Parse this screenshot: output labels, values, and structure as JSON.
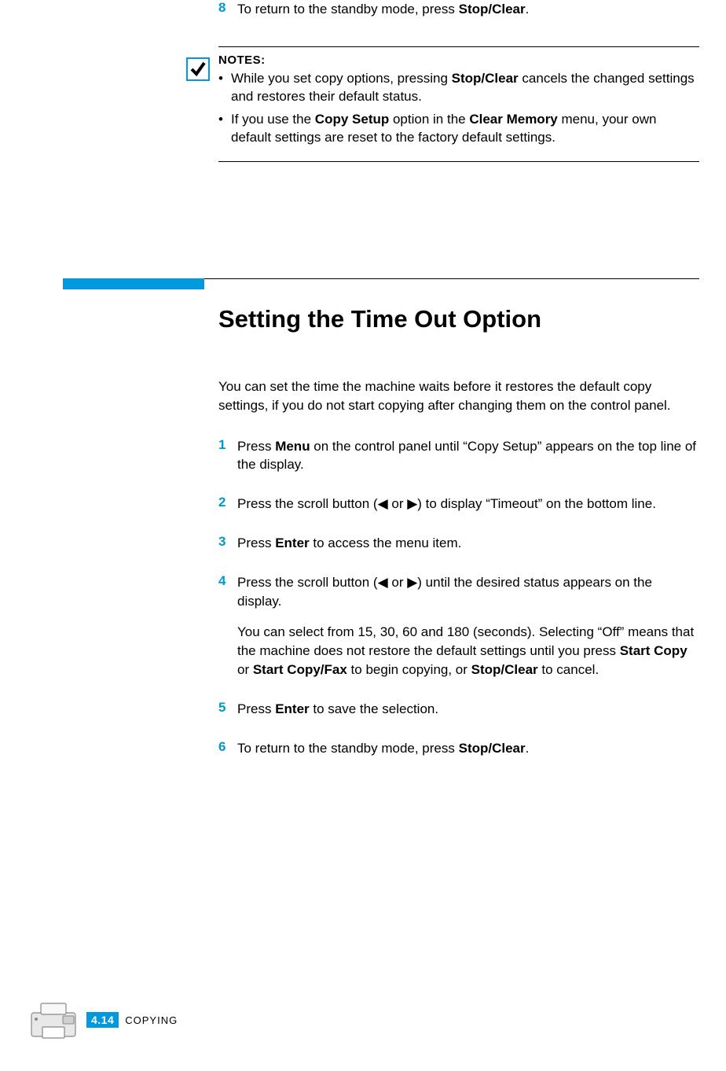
{
  "top_step": {
    "number": "8",
    "text_pre": "To return to the standby mode, press ",
    "bold1": "Stop/Clear",
    "text_post": "."
  },
  "notes": {
    "title": "NOTES:",
    "item1": {
      "pre": "While you set copy options, pressing ",
      "bold": "Stop/Clear",
      "post": " cancels the changed settings and restores their default status."
    },
    "item2": {
      "pre": "If you use the ",
      "bold1": "Copy Setup",
      "mid": " option in the ",
      "bold2": "Clear Memory",
      "post": " menu, your own default settings are reset to the factory default settings."
    }
  },
  "heading": "Setting the Time Out Option",
  "intro": "You can set the time the machine waits before it restores the default copy settings, if you do not start copying after changing them on the control panel.",
  "steps": {
    "s1": {
      "n": "1",
      "pre": "Press ",
      "bold": "Menu",
      "post": " on the control panel until “Copy Setup” appears on the top line of the display."
    },
    "s2": {
      "n": "2",
      "pre": "Press the scroll button (",
      "tri_left": "◀",
      "mid": " or ",
      "tri_right": "▶",
      "post": ") to display “Timeout” on the bottom line."
    },
    "s3": {
      "n": "3",
      "pre": "Press ",
      "bold": "Enter",
      "post": " to access the menu item."
    },
    "s4": {
      "n": "4",
      "pre": "Press the scroll button (",
      "tri_left": "◀",
      "mid": " or ",
      "tri_right": "▶",
      "post": ") until the desired status appears on the display.",
      "sub_pre": "You can select from 15, 30, 60 and 180 (seconds). Selecting “Off” means that the machine does not restore the default settings until you press ",
      "sub_b1": "Start Copy",
      "sub_mid1": " or ",
      "sub_b2": "Start Copy/Fax",
      "sub_mid2": " to begin copying, or ",
      "sub_b3": "Stop/Clear",
      "sub_post": " to cancel."
    },
    "s5": {
      "n": "5",
      "pre": "Press ",
      "bold": "Enter",
      "post": " to save the selection."
    },
    "s6": {
      "n": "6",
      "pre": "To return to the standby mode, press ",
      "bold": "Stop/Clear",
      "post": "."
    }
  },
  "footer": {
    "page": "4.14",
    "section": "COPYING"
  }
}
